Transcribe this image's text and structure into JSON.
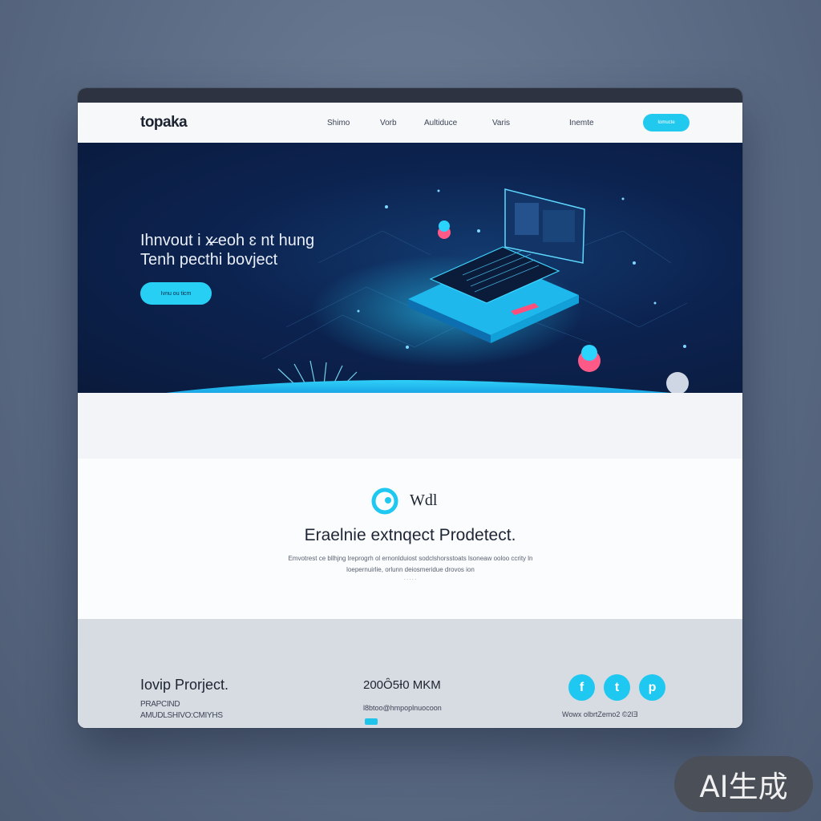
{
  "navbar": {
    "logo": "topaka",
    "links": [
      "Shimo",
      "Vorb",
      "Aultiduce",
      "Varis",
      "Inemte"
    ],
    "cta_label": "Iomucte"
  },
  "hero": {
    "title_line1": "Ihnvout i x̷̶ eoh ɛ nt hung",
    "title_line2": "Tenh pecthi bovject",
    "button_label": "Ivnu ou ticm"
  },
  "content": {
    "brand": "Wdl",
    "title": "Eraelnie extnqect Prodetect.",
    "description": "Emvotrest ce bllhjng lreprogrh ol ernonlduiost sodclshorsstoats lsoneaw ooloo ccrity ln loepernuirlie, orlunn deiosmeridue drovos ion",
    "more": "∙ ∙ ∙ ∙ ∙"
  },
  "footer": {
    "title": "Iovip Prorject.",
    "subtitle_line1": "PRAPCIND",
    "subtitle_line2": "AMUDLSHIVO:CMIYHS",
    "phone": "200Ȏ5Ɨ0 MKM",
    "email": "l8btoo@hmpoplnuocoon",
    "copyright": "Wowx olbrtZemo2  ©2ƖƎ",
    "social": [
      "f",
      "t",
      "p"
    ]
  },
  "watermark": "AI生成",
  "colors": {
    "accent": "#22c9ef",
    "hero_bg": "#0c2350",
    "footer_bg": "#d7dbe2"
  }
}
